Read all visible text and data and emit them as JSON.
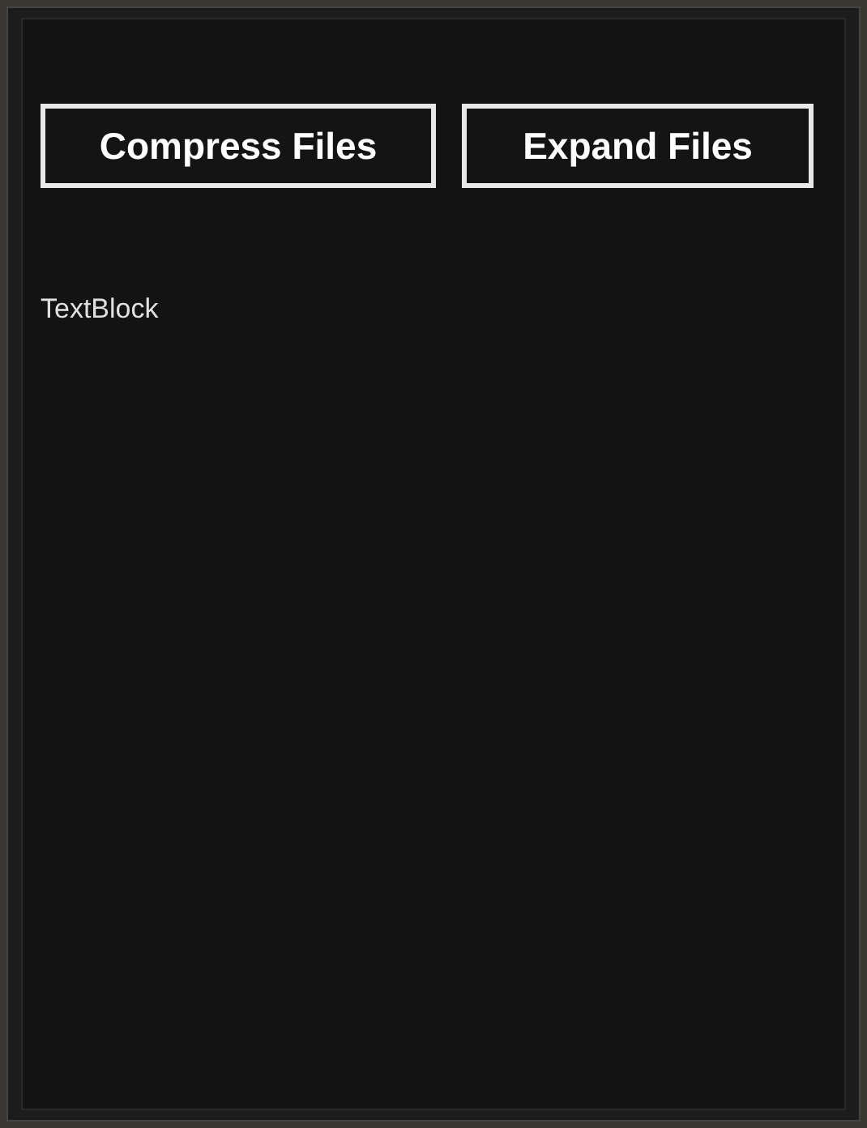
{
  "buttons": [
    {
      "label": "Compress Files"
    },
    {
      "label": "Expand Files"
    }
  ],
  "text_block": "TextBlock"
}
